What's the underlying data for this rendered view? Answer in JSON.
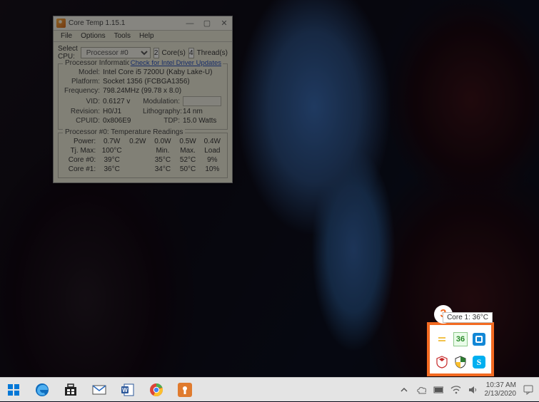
{
  "window": {
    "title": "Core Temp 1.15.1",
    "menus": [
      "File",
      "Options",
      "Tools",
      "Help"
    ],
    "select_cpu_label": "Select CPU:",
    "processor_dropdown": "Processor #0",
    "cores_num": "2",
    "cores_label": "Core(s)",
    "threads_num": "4",
    "threads_label": "Thread(s)",
    "proc_info_legend": "Processor Information",
    "driver_link": "Check for Intel Driver Updates",
    "info": {
      "model_label": "Model:",
      "model_value": "Intel Core i5 7200U (Kaby Lake-U)",
      "platform_label": "Platform:",
      "platform_value": "Socket 1356 (FCBGA1356)",
      "frequency_label": "Frequency:",
      "frequency_value": "798.24MHz (99.78 x 8.0)",
      "vid_label": "VID:",
      "vid_value": "0.6127 v",
      "modulation_label": "Modulation:",
      "revision_label": "Revision:",
      "revision_value": "H0/J1",
      "lithography_label": "Lithography:",
      "lithography_value": "14 nm",
      "cpuid_label": "CPUID:",
      "cpuid_value": "0x806E9",
      "tdp_label": "TDP:",
      "tdp_value": "15.0 Watts"
    },
    "temp_legend": "Processor #0: Temperature Readings",
    "temp": {
      "power_label": "Power:",
      "power_values": [
        "0.7W",
        "0.2W",
        "0.0W",
        "0.5W",
        "0.4W"
      ],
      "tjmax_label": "Tj. Max:",
      "tjmax_value": "100°C",
      "col_min": "Min.",
      "col_max": "Max.",
      "col_load": "Load",
      "core0_label": "Core #0:",
      "core0": [
        "39°C",
        "35°C",
        "52°C",
        "9%"
      ],
      "core1_label": "Core #1:",
      "core1": [
        "36°C",
        "34°C",
        "50°C",
        "10%"
      ]
    }
  },
  "tray": {
    "tooltip": "Core 1: 36°C",
    "core_temp_display": "36",
    "step_number": "3"
  },
  "taskbar": {
    "time": "10:37 AM",
    "date": "2/13/2020"
  }
}
